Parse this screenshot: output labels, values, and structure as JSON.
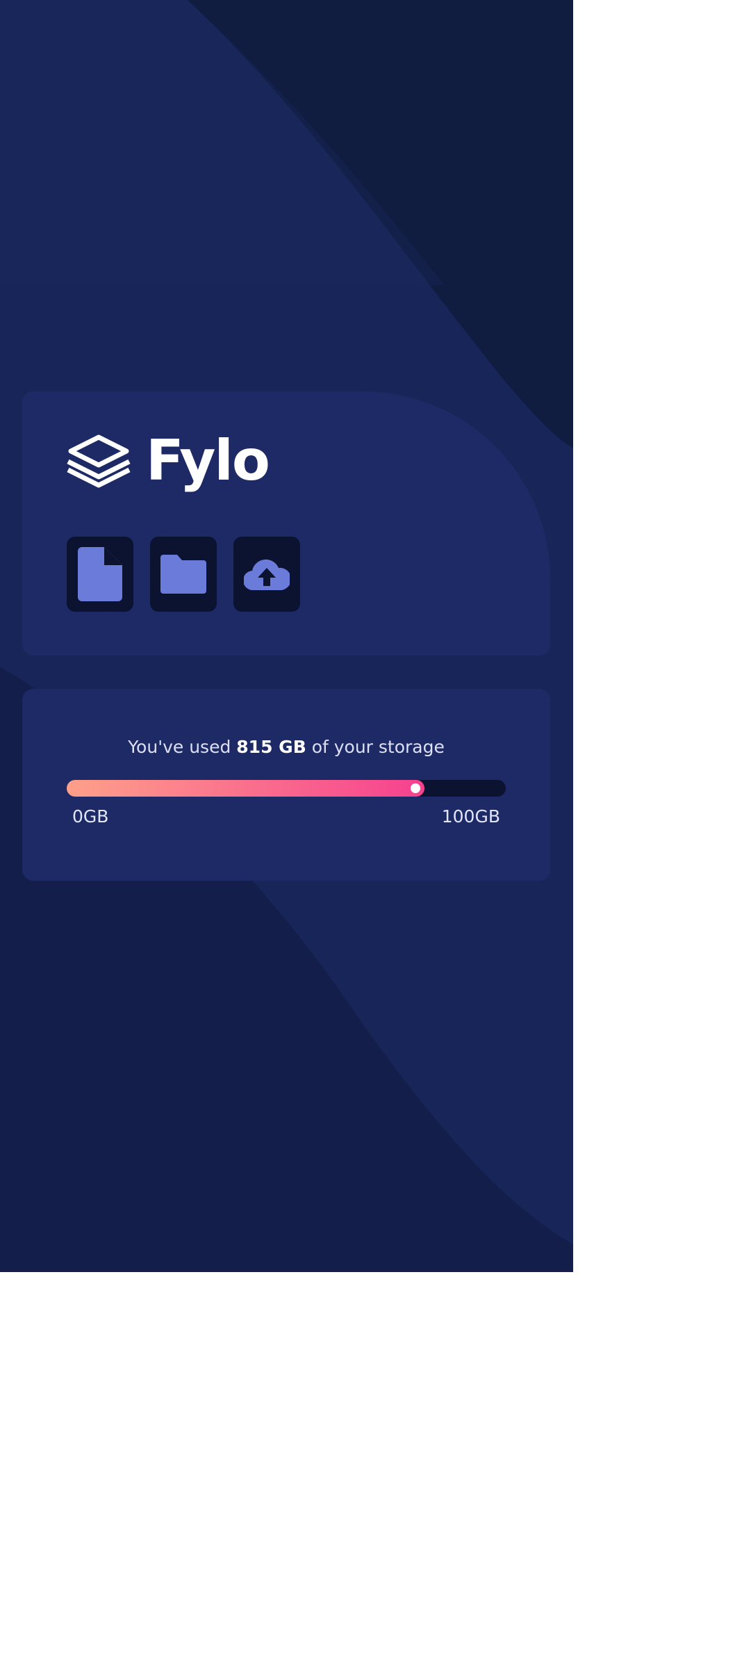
{
  "brand": {
    "name": "Fylo",
    "logo_icon": "stacked-layers-icon"
  },
  "icons": [
    {
      "name": "document-icon"
    },
    {
      "name": "folder-icon"
    },
    {
      "name": "cloud-upload-icon"
    }
  ],
  "storage": {
    "prefix": "You've used",
    "used": "815 GB",
    "suffix": "of your storage",
    "progress": 0.815,
    "min_label": "0GB",
    "max_label": "100GB"
  },
  "colors": {
    "background": "#101c40",
    "card": "#1d2a66",
    "tile": "#0c1330",
    "icon": "#6b7bd9",
    "gradient_start": "#fea08a",
    "gradient_end": "#f6418f"
  }
}
